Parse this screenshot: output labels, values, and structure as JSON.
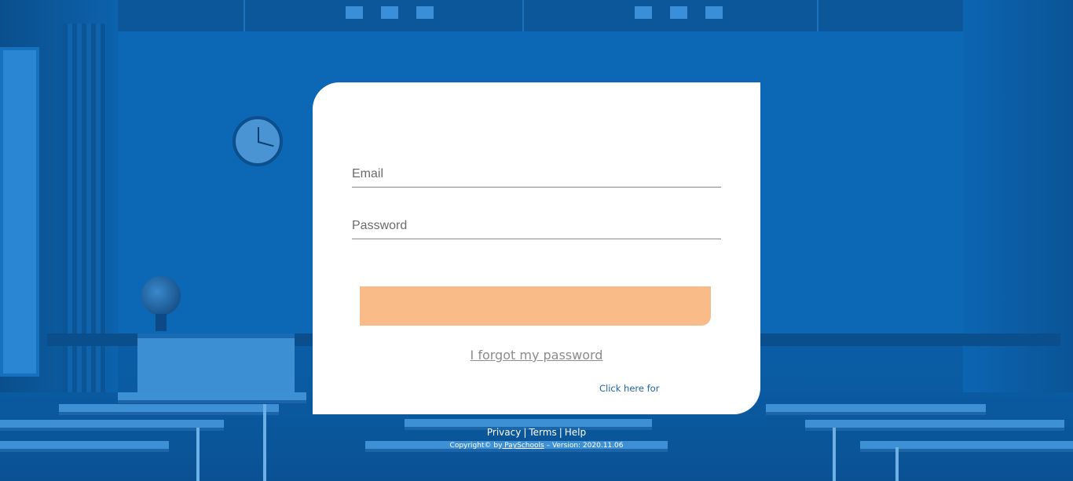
{
  "login": {
    "email_placeholder": "Email",
    "password_placeholder": "Password",
    "login_button_label": "",
    "forgot_password": "I forgot my password",
    "click_here": "Click here for"
  },
  "footer": {
    "privacy": "Privacy",
    "terms": "Terms",
    "help": "Help",
    "separator": "|",
    "copyright_prefix": "Copyright© by",
    "brand": " PaySchools",
    "version": " – Version: 2020.11.06"
  },
  "colors": {
    "background_blue": "#0a5fa8",
    "button_orange": "#f9bb88",
    "link_gray": "#8c8c8c",
    "link_blue": "#1e63a8"
  }
}
